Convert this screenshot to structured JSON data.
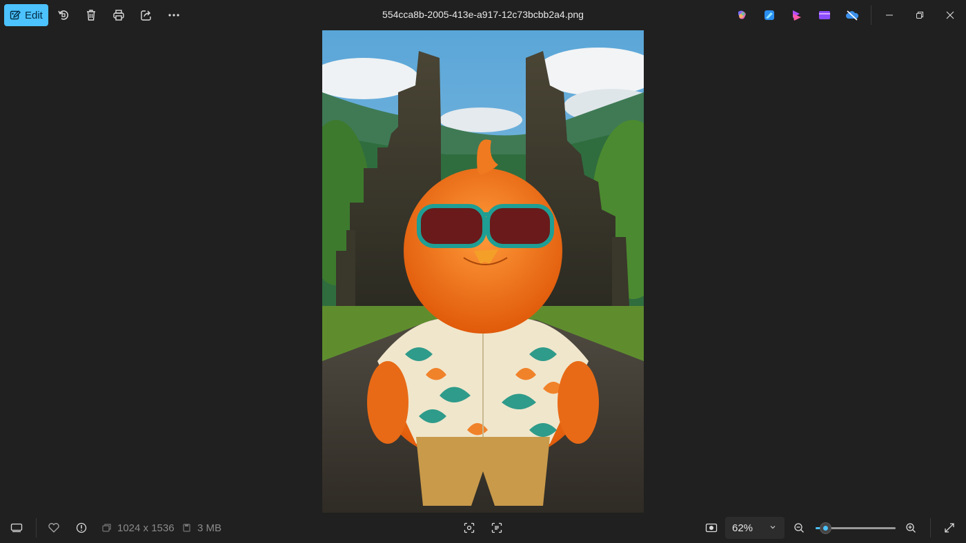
{
  "toolbar": {
    "edit_label": "Edit",
    "icons": [
      "edit-icon",
      "rotate-icon",
      "delete-icon",
      "print-icon",
      "share-icon",
      "more-icon"
    ]
  },
  "window": {
    "title": "554cca8b-2005-413e-a917-12c73bcbb2a4.png",
    "app_icons": [
      "copilot-icon",
      "designer-icon",
      "clipchamp-icon",
      "clipchamp-video-icon",
      "onedrive-icon"
    ],
    "controls": [
      "minimize-icon",
      "restore-icon",
      "close-icon"
    ]
  },
  "photo": {
    "description_subject": "orange bird mascot in sunglasses and tropical shirt"
  },
  "statusbar": {
    "dimensions": "1024 x 1536",
    "size": "3 MB",
    "zoom_value": "62%",
    "zoom_level": 0.12
  },
  "colors": {
    "accent": "#4cc2ff",
    "background": "#202020"
  }
}
